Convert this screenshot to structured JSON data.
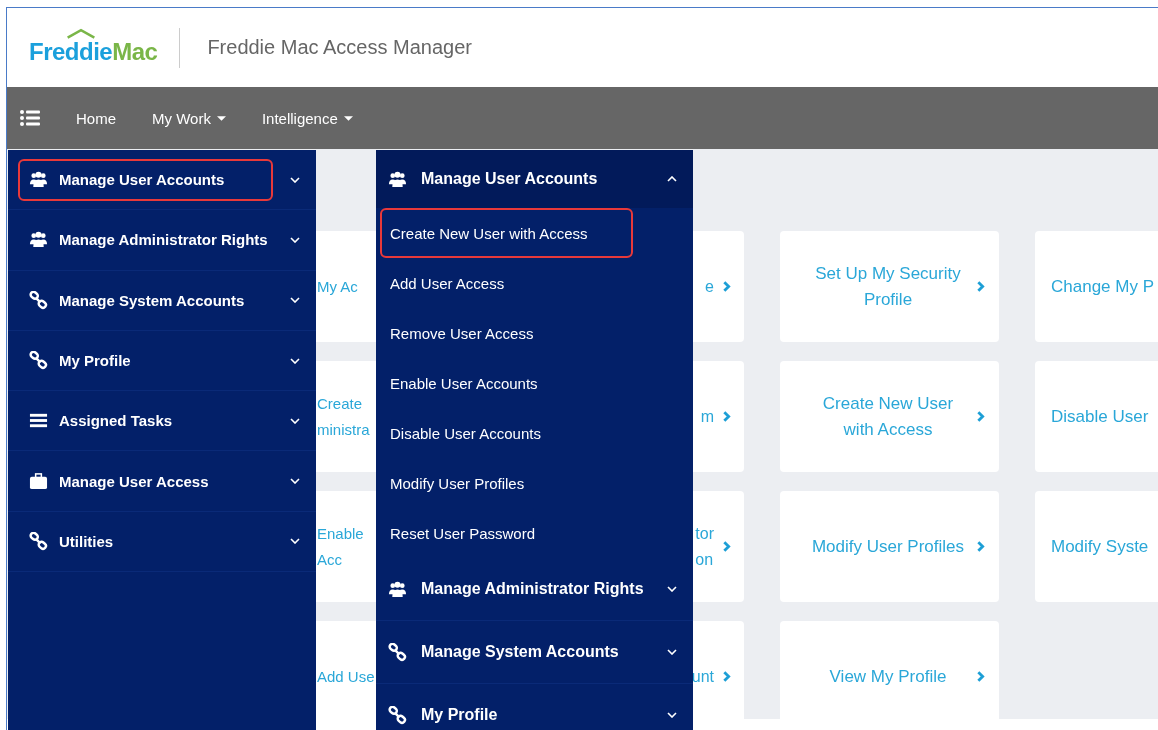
{
  "header": {
    "logo": {
      "part_1": "Freddie",
      "part_2": "Mac"
    },
    "title": "Freddie Mac Access Manager"
  },
  "navbar": {
    "items": [
      {
        "label": "Home",
        "dropdown": false
      },
      {
        "label": "My Work",
        "dropdown": true
      },
      {
        "label": "Intelligence",
        "dropdown": true
      }
    ]
  },
  "cards": {
    "columns": [
      {
        "kind": "hidden-left",
        "cards": [
          {
            "lines": [
              "My Ac"
            ]
          },
          {
            "lines": [
              "Create",
              "ministra"
            ]
          },
          {
            "lines": [
              "Enable",
              "Acc"
            ]
          },
          {
            "lines": [
              "Add Use"
            ]
          }
        ]
      },
      {
        "kind": "hidden-right",
        "cards": [
          {
            "lines": [
              "e"
            ]
          },
          {
            "lines": [
              "m"
            ]
          },
          {
            "lines": [
              "tor",
              "on"
            ]
          },
          {
            "lines": [
              "unt"
            ]
          }
        ]
      },
      {
        "kind": "full",
        "cards": [
          {
            "lines": [
              "Set Up My Security Profile"
            ]
          },
          {
            "lines": [
              "Create New User with Access"
            ]
          },
          {
            "lines": [
              "Modify User Profiles"
            ]
          },
          {
            "lines": [
              "View My Profile"
            ]
          }
        ]
      },
      {
        "kind": "cut",
        "cards": [
          {
            "lines": [
              "Change My P"
            ]
          },
          {
            "lines": [
              "Disable User"
            ]
          },
          {
            "lines": [
              "Modify Syste"
            ]
          }
        ]
      }
    ]
  },
  "sidebar": {
    "items": [
      {
        "label": "Manage User Accounts",
        "kind": "group",
        "selected": true,
        "expanded": false
      },
      {
        "label": "Manage Administrator Rights",
        "kind": "group",
        "selected": false,
        "expanded": false
      },
      {
        "label": "Manage System Accounts",
        "kind": "link",
        "selected": false,
        "expanded": false
      },
      {
        "label": "My Profile",
        "kind": "link",
        "selected": false,
        "expanded": false
      },
      {
        "label": "Assigned Tasks",
        "kind": "list",
        "selected": false,
        "expanded": false
      },
      {
        "label": "Manage User Access",
        "kind": "case",
        "selected": false,
        "expanded": false
      },
      {
        "label": "Utilities",
        "kind": "link",
        "selected": false,
        "expanded": false
      }
    ]
  },
  "flyout": {
    "sections": [
      {
        "label": "Manage User Accounts",
        "kind": "group",
        "expanded": true,
        "children": [
          {
            "label": "Create New User with Access",
            "selected": true
          },
          {
            "label": "Add User Access",
            "selected": false
          },
          {
            "label": "Remove User Access",
            "selected": false
          },
          {
            "label": "Enable User Accounts",
            "selected": false
          },
          {
            "label": "Disable User Accounts",
            "selected": false
          },
          {
            "label": "Modify User Profiles",
            "selected": false
          },
          {
            "label": "Reset User Password",
            "selected": false
          }
        ]
      },
      {
        "label": "Manage Administrator Rights",
        "kind": "group",
        "expanded": false
      },
      {
        "label": "Manage System Accounts",
        "kind": "link",
        "expanded": false
      },
      {
        "label": "My Profile",
        "kind": "link",
        "expanded": false
      }
    ]
  }
}
